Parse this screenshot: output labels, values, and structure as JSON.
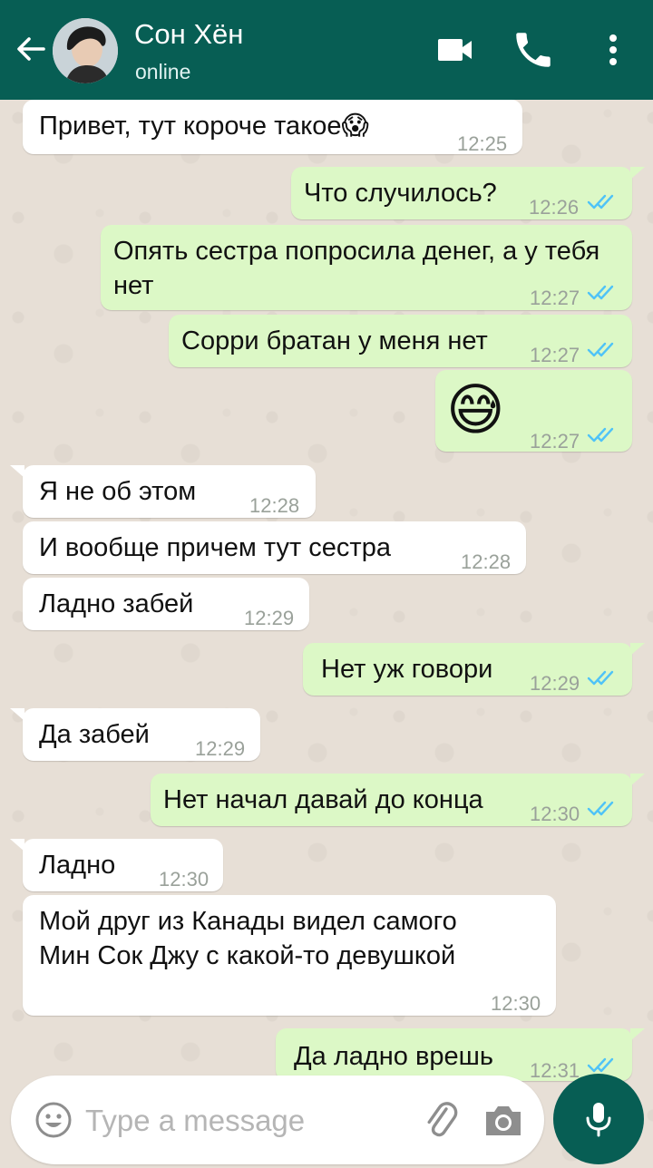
{
  "header": {
    "contact_name": "Сон Хён",
    "status": "online"
  },
  "messages": [
    {
      "dir": "in",
      "text": "Привет, тут короче такое😱",
      "time": "12:25"
    },
    {
      "dir": "out",
      "text": "Что случилось?",
      "time": "12:26",
      "read": true
    },
    {
      "dir": "out",
      "text": "Опять сестра попросила денег, а у тебя нет",
      "time": "12:27",
      "read": true
    },
    {
      "dir": "out",
      "text": "Сорри братан у меня нет",
      "time": "12:27",
      "read": true
    },
    {
      "dir": "out",
      "text": "😅",
      "time": "12:27",
      "read": true
    },
    {
      "dir": "in",
      "text": "Я не об этом",
      "time": "12:28"
    },
    {
      "dir": "in",
      "text": "И вообще причем тут сестра",
      "time": "12:28"
    },
    {
      "dir": "in",
      "text": "Ладно забей",
      "time": "12:29"
    },
    {
      "dir": "out",
      "text": "Нет уж говори",
      "time": "12:29",
      "read": true
    },
    {
      "dir": "in",
      "text": "Да забей",
      "time": "12:29"
    },
    {
      "dir": "out",
      "text": "Нет начал давай до конца",
      "time": "12:30",
      "read": true
    },
    {
      "dir": "in",
      "text": "Ладно",
      "time": "12:30"
    },
    {
      "dir": "in",
      "text": "Мой друг из Канады видел самого Мин Сок Джу с какой-то девушкой",
      "time": "12:30"
    },
    {
      "dir": "out",
      "text": "Да ладно врешь",
      "time": "12:31",
      "read": true
    }
  ],
  "composer": {
    "placeholder": "Type a message"
  },
  "colors": {
    "header": "#075e54",
    "outgoing_bubble": "#dcf8c6",
    "incoming_bubble": "#ffffff",
    "read_ticks": "#4fc3f7"
  },
  "icons": {
    "back": "back-arrow-icon",
    "video": "video-camera-icon",
    "call": "phone-icon",
    "menu": "more-vert-icon",
    "emoji": "emoji-icon",
    "attach": "paperclip-icon",
    "camera": "camera-icon",
    "mic": "microphone-icon"
  }
}
